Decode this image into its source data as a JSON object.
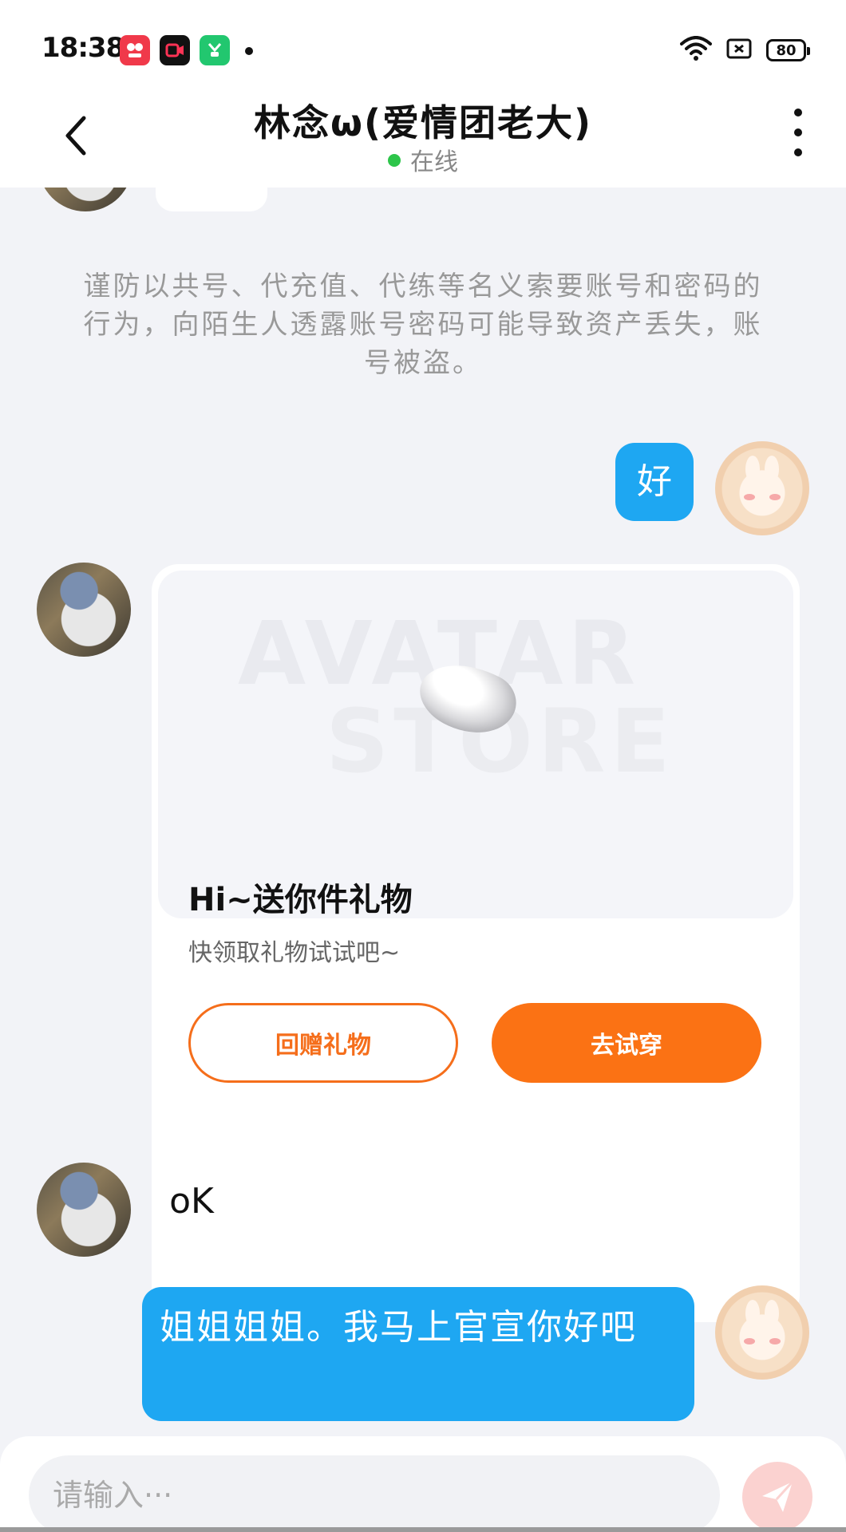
{
  "status_bar": {
    "time": "18:38",
    "battery": "80",
    "app_icons": [
      "xiaohongshu-icon",
      "video-icon",
      "green-app-icon"
    ],
    "right_icons": [
      "wifi-icon",
      "screenshot-icon",
      "battery-icon"
    ]
  },
  "header": {
    "title": "林念ω(爱情团老大)",
    "status": "在线",
    "status_color": "#2dc54a"
  },
  "chat": {
    "notice": "谨防以共号、代充值、代练等名义索要账号和密码的行为，向陌生人透露账号密码可能导致资产丢失，账号被盗。",
    "messages": [
      {
        "from": "me",
        "text": "好"
      },
      {
        "from": "them",
        "type": "gift_card",
        "watermark_line1": "AVATAR",
        "watermark_line2": "STORE",
        "title": "Hi~送你件礼物",
        "subtitle": "快领取礼物试试吧~",
        "button_return": "回赠礼物",
        "button_try": "去试穿"
      },
      {
        "from": "them",
        "text": "oK"
      },
      {
        "from": "me",
        "text": "姐姐姐姐。我马上官宣你好吧"
      }
    ]
  },
  "input": {
    "placeholder": "请输入···"
  },
  "colors": {
    "accent_orange": "#fb7214",
    "bubble_blue": "#1ea7f2",
    "background": "#f2f3f7"
  }
}
